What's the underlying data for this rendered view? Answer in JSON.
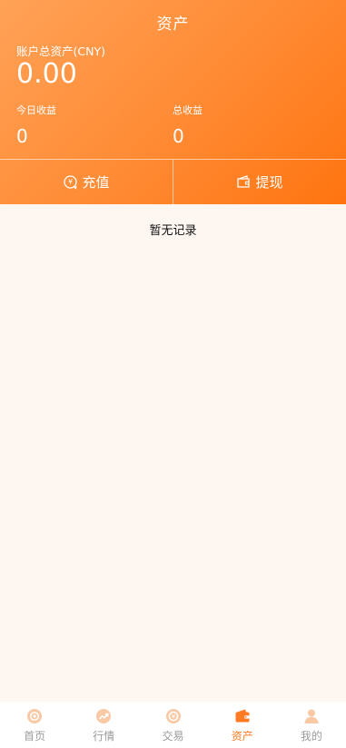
{
  "header": {
    "title": "资产",
    "total_assets_label": "账户总资产(CNY)",
    "total_assets_value": "0.00",
    "today_income_label": "今日收益",
    "today_income_value": "0",
    "total_income_label": "总收益",
    "total_income_value": "0"
  },
  "actions": {
    "recharge_label": "充值",
    "recharge_icon": "coin-refresh-icon",
    "withdraw_label": "提现",
    "withdraw_icon": "wallet-icon"
  },
  "records": {
    "empty_text": "暂无记录"
  },
  "tabbar": {
    "active_index": 3,
    "tabs": [
      {
        "label": "首页",
        "icon": "home-icon"
      },
      {
        "label": "行情",
        "icon": "trend-icon"
      },
      {
        "label": "交易",
        "icon": "trade-icon"
      },
      {
        "label": "资产",
        "icon": "wallet-icon"
      },
      {
        "label": "我的",
        "icon": "user-icon"
      }
    ]
  },
  "colors": {
    "accent": "#ff7a22",
    "gradient_start": "#ffa257",
    "gradient_end": "#ff7410",
    "inactive_icon": "#f8c9a4",
    "background": "#fef6f1"
  }
}
